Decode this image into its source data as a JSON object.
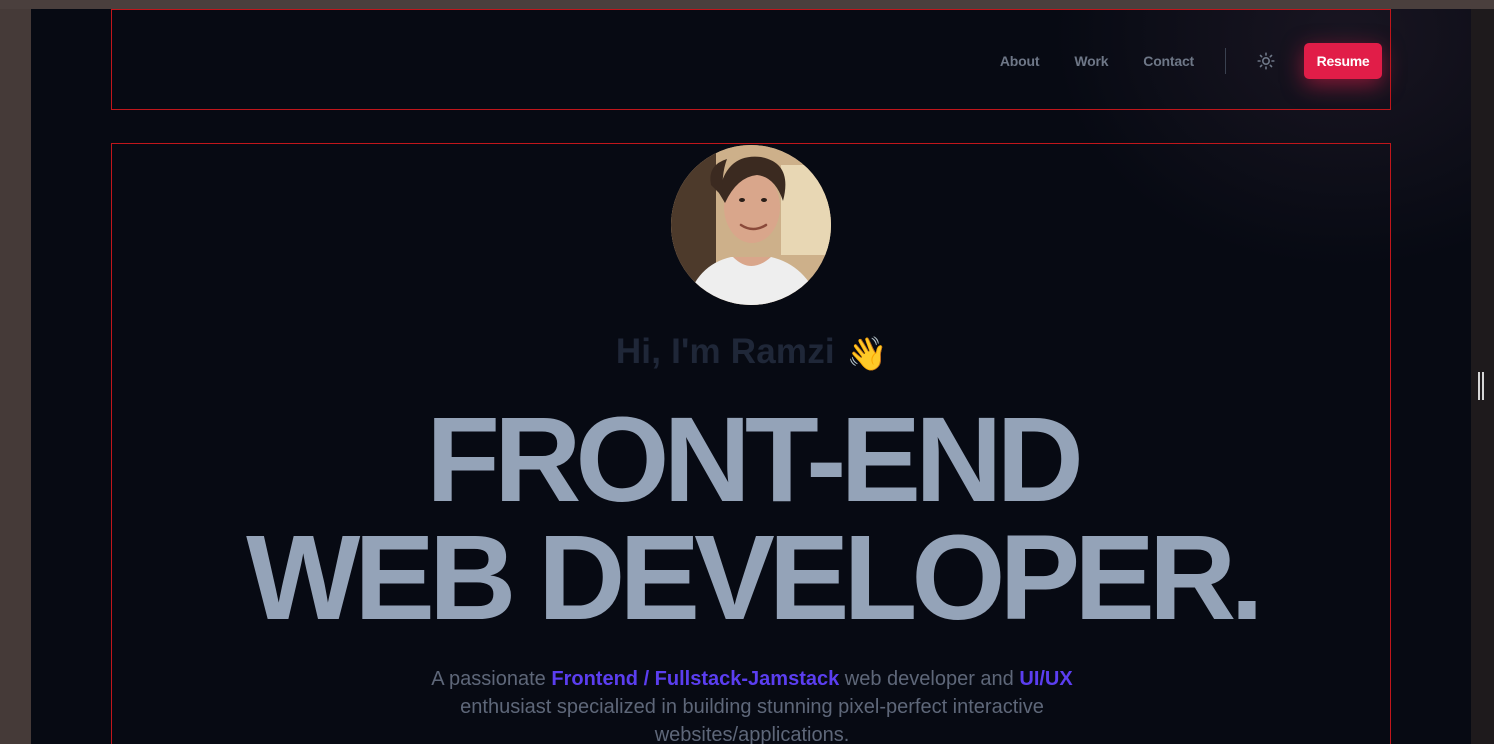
{
  "nav": {
    "links": [
      "About",
      "Work",
      "Contact"
    ],
    "theme_icon": "sun-icon",
    "resume_label": "Resume"
  },
  "hero": {
    "greeting": "Hi, I'm Ramzi",
    "greeting_emoji": "👋",
    "headline_line1": "FRONT-END",
    "headline_line2": "WEB DEVELOPER.",
    "tagline_part1": "A passionate ",
    "tagline_highlight1": "Frontend / Fullstack-Jamstack",
    "tagline_part2": " web developer and ",
    "tagline_highlight2": "UI/UX",
    "tagline_part3": " enthusiast specialized in building stunning pixel-perfect interactive websites/applications."
  },
  "colors": {
    "background": "#070a13",
    "accent": "#e11d48",
    "highlight": "#5b3ef0",
    "headline": "#94a3b8"
  }
}
